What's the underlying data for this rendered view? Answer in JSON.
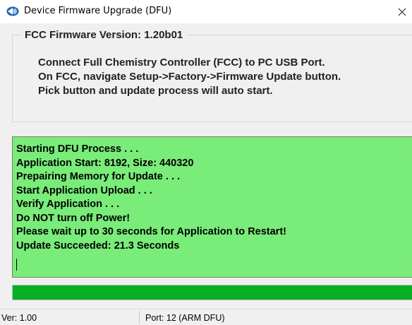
{
  "window": {
    "title": "Device Firmware Upgrade (DFU)",
    "icon": "dfu-app-icon",
    "close_icon": "close-icon"
  },
  "firmware": {
    "legend": "FCC Firmware Version: 1.20b01",
    "instructions": [
      "Connect Full Chemistry Controller (FCC) to PC USB Port.",
      "On FCC, navigate Setup->Factory->Firmware Update button.",
      "Pick button and update process will auto start."
    ]
  },
  "log": {
    "background_color": "#79ec79",
    "lines": [
      "Starting DFU Process . . .",
      "Application Start: 8192, Size: 440320",
      "Prepairing Memory for Update . . .",
      "Start Application Upload . . .",
      "Verify Application . . .",
      "Do NOT turn off Power!",
      "Please wait up to 30 seconds for Application to Restart!",
      "Update Succeeded: 21.3 Seconds"
    ]
  },
  "progress": {
    "percent": 100,
    "fill_color": "#06b025"
  },
  "status": {
    "version": "Ver: 1.00",
    "port": "Port: 12 (ARM DFU)"
  }
}
